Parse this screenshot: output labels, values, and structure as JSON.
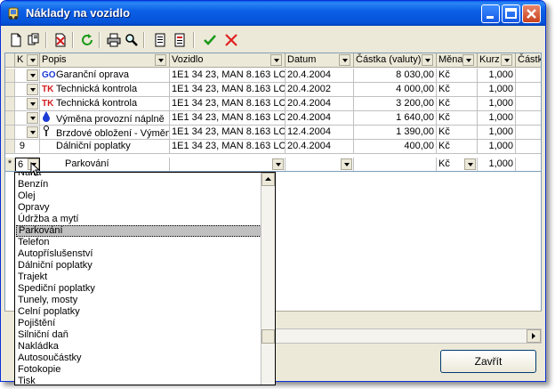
{
  "window": {
    "title": "Náklady na vozidlo",
    "controls": {
      "minimize": "_",
      "maximize": "□",
      "close": "×"
    }
  },
  "toolbar": {
    "tools": [
      {
        "name": "new-record-icon"
      },
      {
        "name": "copy-record-icon"
      },
      {
        "name": "delete-record-icon"
      },
      {
        "name": "refresh-icon"
      },
      {
        "name": "print-icon"
      },
      {
        "name": "search-icon"
      },
      {
        "name": "list-view-icon"
      },
      {
        "name": "report-icon"
      },
      {
        "name": "confirm-check-icon"
      },
      {
        "name": "cancel-x-icon"
      }
    ]
  },
  "grid": {
    "columns": [
      {
        "label": "K"
      },
      {
        "label": "Popis"
      },
      {
        "label": "Vozidlo"
      },
      {
        "label": "Datum"
      },
      {
        "label": "Částka (valuty)"
      },
      {
        "label": "Měna"
      },
      {
        "label": "Kurz"
      },
      {
        "label": "Částk"
      }
    ],
    "rows": [
      {
        "marker": "",
        "k": "",
        "code": "GO",
        "code_color": "#1c3bd6",
        "popis": "Garanční oprava",
        "vozidlo": "1E1 34 23, MAN 8.163 LC",
        "datum": "20.4.2004",
        "castka": "8 030,00",
        "mena": "Kč",
        "kurz": "1,000"
      },
      {
        "marker": "",
        "k": "",
        "code": "TK",
        "code_color": "#d21c1c",
        "popis": "Technická kontrola",
        "vozidlo": "1E1 34 23, MAN 8.163 LC",
        "datum": "20.4.2002",
        "castka": "4 000,00",
        "mena": "Kč",
        "kurz": "1,000"
      },
      {
        "marker": "",
        "k": "",
        "code": "TK",
        "code_color": "#d21c1c",
        "popis": "Technická kontrola",
        "vozidlo": "1E1 34 23, MAN 8.163 LC",
        "datum": "20.4.2004",
        "castka": "3 200,00",
        "mena": "Kč",
        "kurz": "1,000"
      },
      {
        "marker": "",
        "k": "",
        "code": "drop",
        "code_color": "#1c3bd6",
        "popis": "Výměna provozní náplně",
        "vozidlo": "1E1 34 23, MAN 8.163 LC",
        "datum": "20.4.2004",
        "castka": "1 640,00",
        "mena": "Kč",
        "kurz": "1,000"
      },
      {
        "marker": "",
        "k": "",
        "code": "tool",
        "code_color": "#000000",
        "popis": "Brzdové obložení - Výměna",
        "vozidlo": "1E1 34 23, MAN 8.163 LC",
        "datum": "12.4.2004",
        "castka": "1 390,00",
        "mena": "Kč",
        "kurz": "1,000"
      },
      {
        "marker": "",
        "k": "9",
        "code": "",
        "code_color": "#000000",
        "popis": "Dálniční poplatky",
        "vozidlo": "1E1 34 23, MAN 8.163 LC",
        "datum": "20.4.2004",
        "castka": "400,00",
        "mena": "Kč",
        "kurz": "1,000"
      }
    ],
    "new_row": {
      "marker": "*",
      "k": "6",
      "popis": "Parkování",
      "vozidlo": "",
      "datum": "",
      "castka": "",
      "mena": "Kč",
      "kurz": "1,000"
    }
  },
  "dropdown": {
    "items": [
      "Nafta",
      "Benzín",
      "Olej",
      "Opravy",
      "Údržba a mytí",
      "Parkování",
      "Telefon",
      "Autopříslušenství",
      "Dálniční poplatky",
      "Trajekt",
      "Spediční poplatky",
      "Tunely, mosty",
      "Celní poplatky",
      "Pojištění",
      "Silniční daň",
      "Nakládka",
      "Autosoučástky",
      "Fotokopie",
      "Tisk"
    ],
    "selected": "Parkování"
  },
  "close_button": {
    "label": "Zavřít"
  }
}
